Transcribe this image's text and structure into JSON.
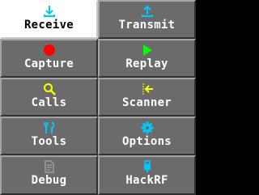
{
  "menu": {
    "items": [
      {
        "label": "Receive",
        "icon": "receive-icon",
        "icon_color": "#00c8ff",
        "selected": true
      },
      {
        "label": "Transmit",
        "icon": "transmit-icon",
        "icon_color": "#00c8ff"
      },
      {
        "label": "Capture",
        "icon": "capture-icon",
        "icon_color": "#ff0000"
      },
      {
        "label": "Replay",
        "icon": "replay-icon",
        "icon_color": "#00ff00"
      },
      {
        "label": "Calls",
        "icon": "calls-icon",
        "icon_color": "#ffff00"
      },
      {
        "label": "Scanner",
        "icon": "scanner-icon",
        "icon_color": "#ffff00"
      },
      {
        "label": "Tools",
        "icon": "tools-icon",
        "icon_color": "#00c8ff"
      },
      {
        "label": "Options",
        "icon": "options-icon",
        "icon_color": "#00c8ff"
      },
      {
        "label": "Debug",
        "icon": "debug-icon",
        "icon_color": "#a0a0a0"
      },
      {
        "label": "HackRF",
        "icon": "hackrf-icon",
        "icon_color": "#00c8ff"
      }
    ]
  },
  "colors": {
    "tile_bg": "#6b6b6b",
    "tile_selected_bg": "#ffffff",
    "text": "#ffffff",
    "text_selected": "#000000"
  }
}
